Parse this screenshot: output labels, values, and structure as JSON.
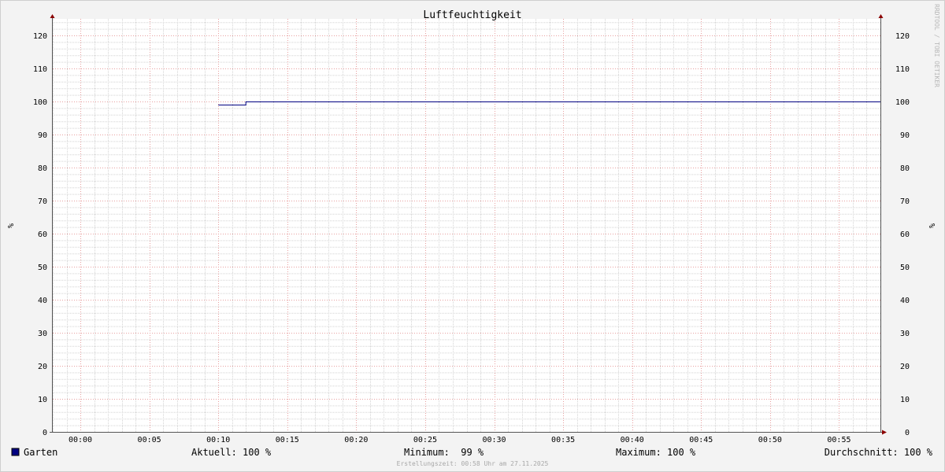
{
  "chart_data": {
    "type": "line",
    "title": "Luftfeuchtigkeit",
    "ylabel": "%",
    "ylim": [
      0,
      125
    ],
    "yticks": [
      0,
      10,
      20,
      30,
      40,
      50,
      60,
      70,
      80,
      90,
      100,
      110,
      120
    ],
    "xlim_minutes": [
      -2,
      58
    ],
    "xticks": [
      {
        "minute": 0,
        "label": "00:00"
      },
      {
        "minute": 5,
        "label": "00:05"
      },
      {
        "minute": 10,
        "label": "00:10"
      },
      {
        "minute": 15,
        "label": "00:15"
      },
      {
        "minute": 20,
        "label": "00:20"
      },
      {
        "minute": 25,
        "label": "00:25"
      },
      {
        "minute": 30,
        "label": "00:30"
      },
      {
        "minute": 35,
        "label": "00:35"
      },
      {
        "minute": 40,
        "label": "00:40"
      },
      {
        "minute": 45,
        "label": "00:45"
      },
      {
        "minute": 50,
        "label": "00:50"
      },
      {
        "minute": 55,
        "label": "00:55"
      }
    ],
    "grid": true,
    "series": [
      {
        "name": "Garten",
        "color": "#000080",
        "points": [
          {
            "x": "00:10",
            "y": 99
          },
          {
            "x": "00:12",
            "y": 99
          },
          {
            "x": "00:12",
            "y": 100
          },
          {
            "x": "00:58",
            "y": 100
          }
        ]
      }
    ]
  },
  "watermark": "RRDTOOL / TOBI OETIKER",
  "legend": {
    "series_name": "Garten",
    "swatch_color": "#000080",
    "current": "Aktuell: 100 %",
    "minimum": "Minimum:  99 %",
    "maximum": "Maximum: 100 %",
    "average": "Durchschnitt: 100 %"
  },
  "footer": "Erstellungszeit: 00:58 Uhr am 27.11.2025",
  "colors": {
    "background": "#f3f3f3",
    "plot_area": "#ffffff",
    "major_grid": "#e8a0a0",
    "minor_grid": "#d4d4d4",
    "axis": "#555555",
    "arrow": "#8b0000"
  }
}
